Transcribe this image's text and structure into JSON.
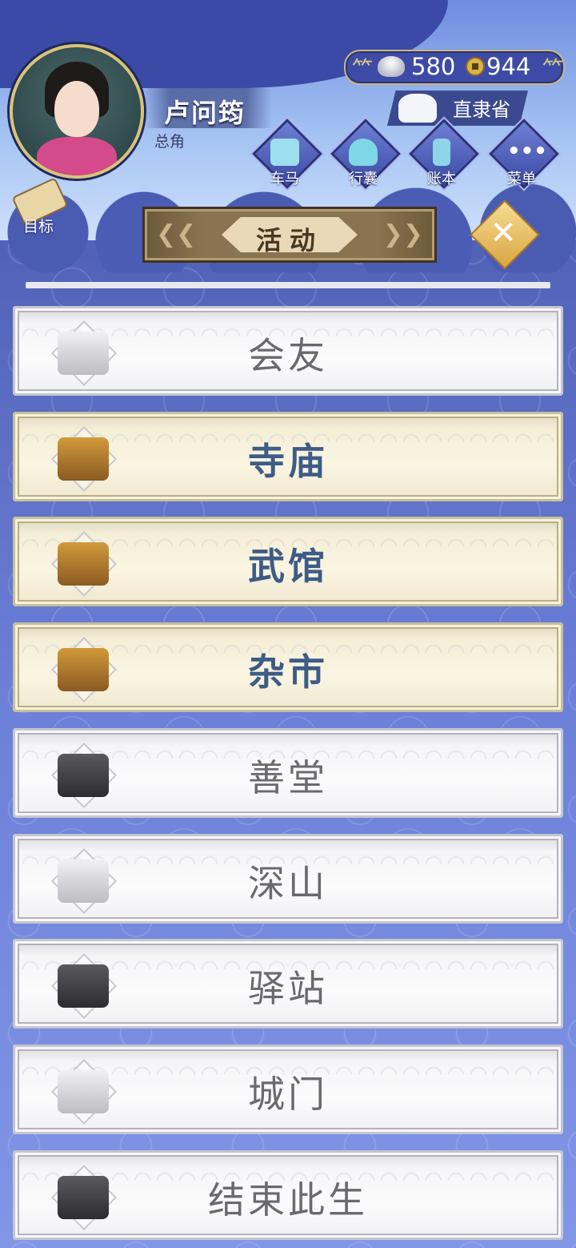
{
  "player": {
    "name": "卢问筠",
    "role": "总角"
  },
  "currency": {
    "silver": "580",
    "copper": "944"
  },
  "location": {
    "label": "直隶省"
  },
  "menu": [
    {
      "label": "车马",
      "icon": "carriage-icon"
    },
    {
      "label": "行囊",
      "icon": "bundle-icon"
    },
    {
      "label": "账本",
      "icon": "ledger-icon"
    },
    {
      "label": "菜单",
      "icon": "more-icon"
    }
  ],
  "target_label": "目标",
  "panel": {
    "title": "活动"
  },
  "activities": [
    {
      "label": "会友",
      "active": false,
      "icon": "teacup-icon"
    },
    {
      "label": "寺庙",
      "active": true,
      "icon": "incense-burner-icon"
    },
    {
      "label": "武馆",
      "active": true,
      "icon": "martial-arts-gate-icon"
    },
    {
      "label": "杂市",
      "active": true,
      "icon": "market-pavilion-icon"
    },
    {
      "label": "善堂",
      "active": false,
      "icon": "charity-hall-icon"
    },
    {
      "label": "深山",
      "active": false,
      "icon": "mountain-icon"
    },
    {
      "label": "驿站",
      "active": false,
      "icon": "post-station-icon"
    },
    {
      "label": "城门",
      "active": false,
      "icon": "city-gate-icon"
    },
    {
      "label": "结束此生",
      "active": false,
      "icon": "moon-night-icon"
    }
  ],
  "colors": {
    "active_text": "#3d5c86",
    "inactive_text": "#6a6a6e",
    "bg": "#5262b8"
  }
}
